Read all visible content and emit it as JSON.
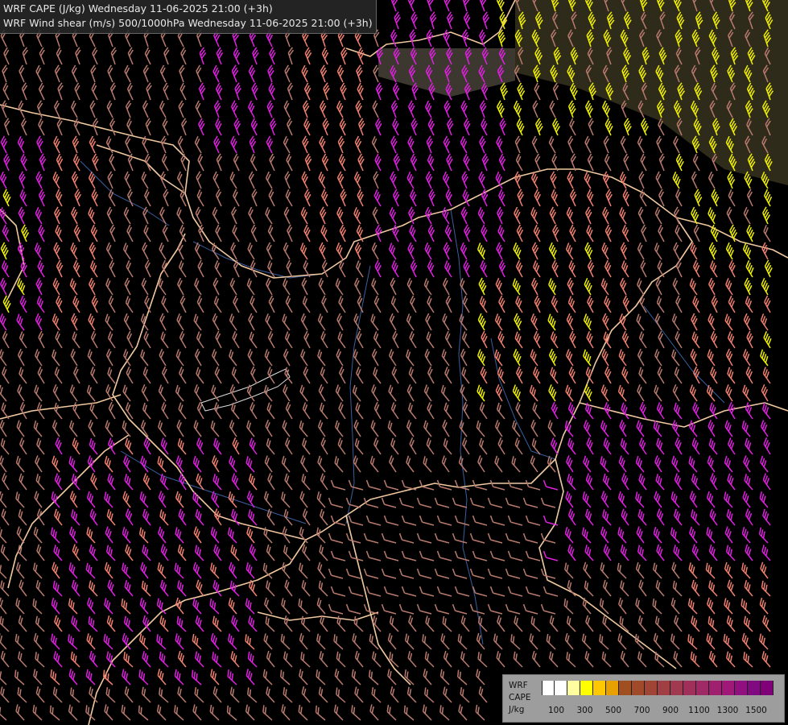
{
  "title": {
    "line1": "WRF CAPE (J/kg) Wednesday 11-06-2025 21:00 (+3h)",
    "line2": "WRF Wind shear (m/s) 500/1000hPa Wednesday 11-06-2025 21:00 (+3h)"
  },
  "legend": {
    "name": "WRF",
    "variable": "CAPE",
    "unit": "J/kg",
    "colors": [
      "#ffffff",
      "#ffffff",
      "#ffffa0",
      "#ffff00",
      "#ffc800",
      "#e6a000",
      "#a05020",
      "#a04a2a",
      "#a04535",
      "#a04045",
      "#a03a50",
      "#a0305a",
      "#a02a66",
      "#a02070",
      "#a01878",
      "#901080",
      "#800a80",
      "#800078"
    ],
    "ticks": [
      "100",
      "300",
      "500",
      "700",
      "900",
      "1100",
      "1300",
      "1500"
    ]
  },
  "barb_colors": {
    "weak": "#b97a6e",
    "moderate": "#f08070",
    "strong": "#e020e0",
    "very_strong": "#f0f000"
  },
  "border_color": "#f0c8a0",
  "river_color": "#3a5fa0"
}
